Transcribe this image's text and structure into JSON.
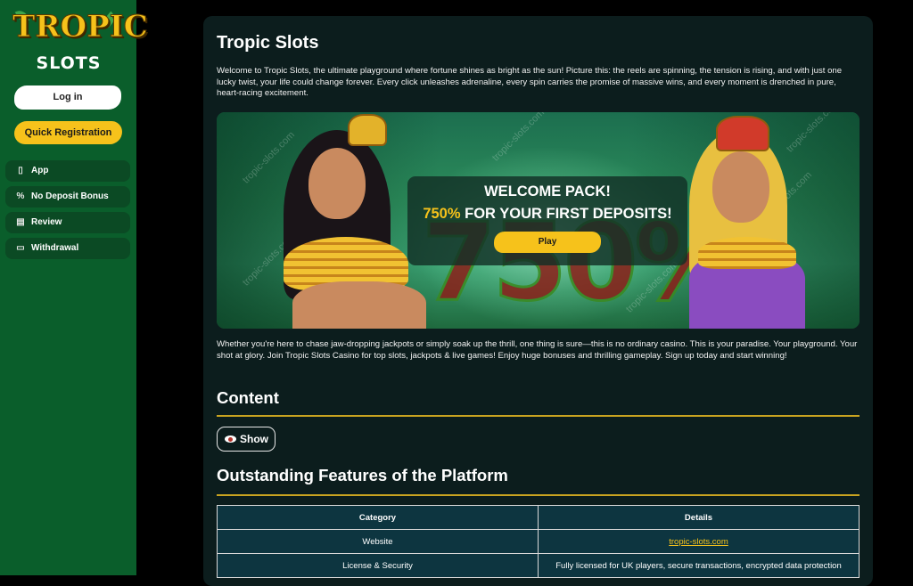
{
  "brand": {
    "logo_top": "TROPIC",
    "logo_bottom": "SLOTS",
    "accent": "#f6c21b",
    "sidebar_bg": "#0a5e2b"
  },
  "sidebar": {
    "login_label": "Log in",
    "register_label": "Quick Registration",
    "items": [
      {
        "label": "App",
        "icon": "phone-icon"
      },
      {
        "label": "No Deposit Bonus",
        "icon": "percent-icon"
      },
      {
        "label": "Review",
        "icon": "document-icon"
      },
      {
        "label": "Withdrawal",
        "icon": "cash-icon"
      }
    ]
  },
  "main": {
    "title": "Tropic Slots",
    "intro": "Welcome to Tropic Slots, the ultimate playground where fortune shines as bright as the sun! Picture this: the reels are spinning, the tension is rising, and with just one lucky twist, your life could change forever. Every click unleashes adrenaline, every spin carries the promise of massive wins, and every moment is drenched in pure, heart-racing excitement.",
    "banner": {
      "headline": "WELCOME PACK!",
      "offer_highlight": "750%",
      "offer_rest": " FOR YOUR FIRST DEPOSITS!",
      "play_label": "Play",
      "watermark": "tropic-slots.com",
      "big_number": "750%"
    },
    "outro": "Whether you're here to chase jaw-dropping jackpots or simply soak up the thrill, one thing is sure—this is no ordinary casino. This is your paradise. Your playground. Your shot at glory. Join Tropic Slots Casino for top slots, jackpots & live games! Enjoy huge bonuses and thrilling gameplay. Sign up today and start winning!",
    "content_heading": "Content",
    "show_label": "Show",
    "features_heading": "Outstanding Features of the Platform",
    "table": {
      "headers": [
        "Category",
        "Details"
      ],
      "rows": [
        [
          "Website",
          "tropic-slots.com"
        ],
        [
          "License & Security",
          "Fully licensed for UK players, secure transactions, encrypted data protection"
        ]
      ]
    }
  }
}
